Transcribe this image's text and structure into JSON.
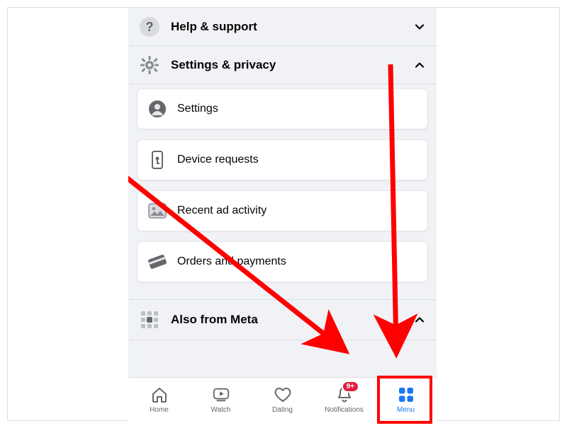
{
  "sections": {
    "help": {
      "label": "Help & support",
      "expanded": false
    },
    "settings": {
      "label": "Settings & privacy",
      "expanded": true
    },
    "meta": {
      "label": "Also from Meta",
      "expanded": true
    }
  },
  "settings_items": [
    {
      "label": "Settings"
    },
    {
      "label": "Device requests"
    },
    {
      "label": "Recent ad activity"
    },
    {
      "label": "Orders and payments"
    }
  ],
  "nav": {
    "home": "Home",
    "watch": "Watch",
    "dating": "Dating",
    "notifications": "Notifications",
    "menu": "Menu",
    "badge": "9+"
  },
  "colors": {
    "accent": "#1877f2",
    "annotation": "#ff0000",
    "badge": "#e41e3f"
  }
}
